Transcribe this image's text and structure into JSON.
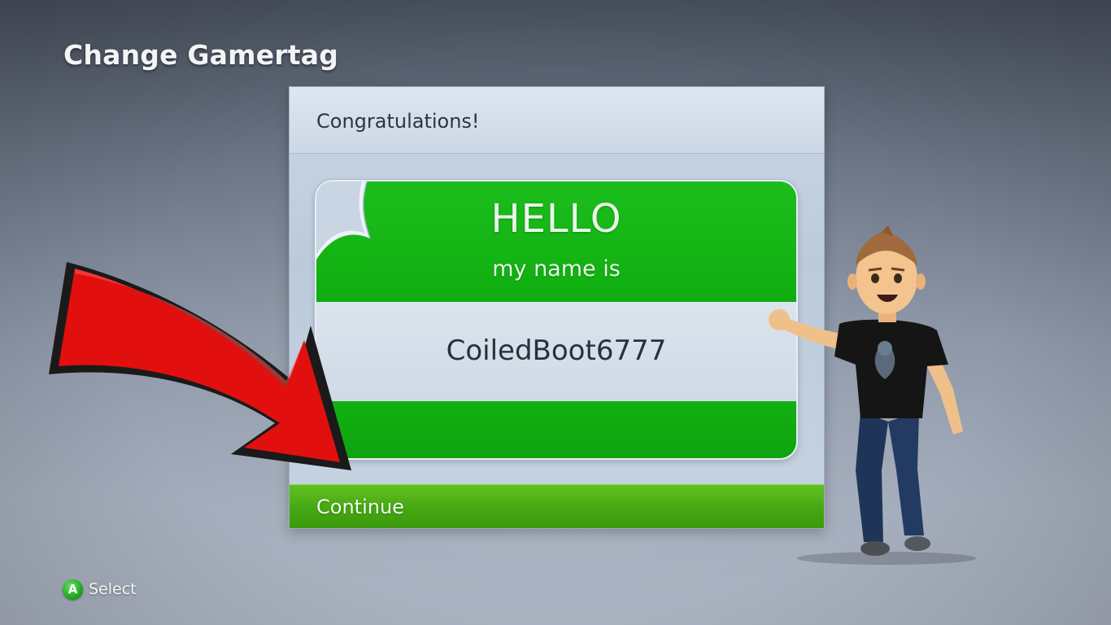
{
  "header": {
    "title": "Change Gamertag"
  },
  "dialog": {
    "title": "Congratulations!",
    "name_tag": {
      "greeting": "HELLO",
      "subtitle": "my name is",
      "gamertag": "CoiledBoot6777"
    },
    "continue_label": "Continue"
  },
  "footer": {
    "button_glyph": "A",
    "action_label": "Select"
  },
  "colors": {
    "accent_green": "#10ae10",
    "continue_green": "#45a812",
    "arrow_red": "#e00d0d"
  },
  "icons": {
    "a_button": "a-button-icon",
    "arrow": "red-arrow-icon",
    "avatar": "avatar-figure"
  }
}
